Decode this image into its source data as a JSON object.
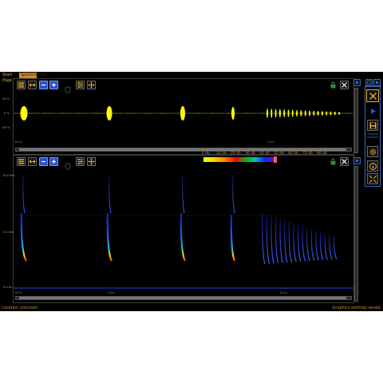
{
  "tabs": [
    {
      "label": "Start Page"
    },
    {
      "label": "Spectrogram"
    }
  ],
  "waveform": {
    "y_labels": [
      "50 %",
      "0 %",
      "-50 %"
    ],
    "x_labels": [
      "0.0 s",
      "1.0 s"
    ]
  },
  "spectrogram": {
    "y_labels": [
      "10.0 kHz",
      "5.0 kHz",
      "0.0 Hz"
    ],
    "x_labels": [
      "0.0 s",
      "1.0 s",
      "2.0 s"
    ],
    "db_legend": [
      "0 db",
      "10 db",
      "20 db",
      "30 db",
      "40 db",
      "50 db",
      "60 db",
      "70 db",
      "80 db"
    ]
  },
  "sidebar": {
    "playing_label": "Playing stopped"
  },
  "status": {
    "left": "Location unknown.",
    "right": "Graphics settings saved."
  },
  "colors": {
    "accent": "#d08a2a",
    "waveform": "#ffff00",
    "button_blue": "#2a50c8"
  }
}
